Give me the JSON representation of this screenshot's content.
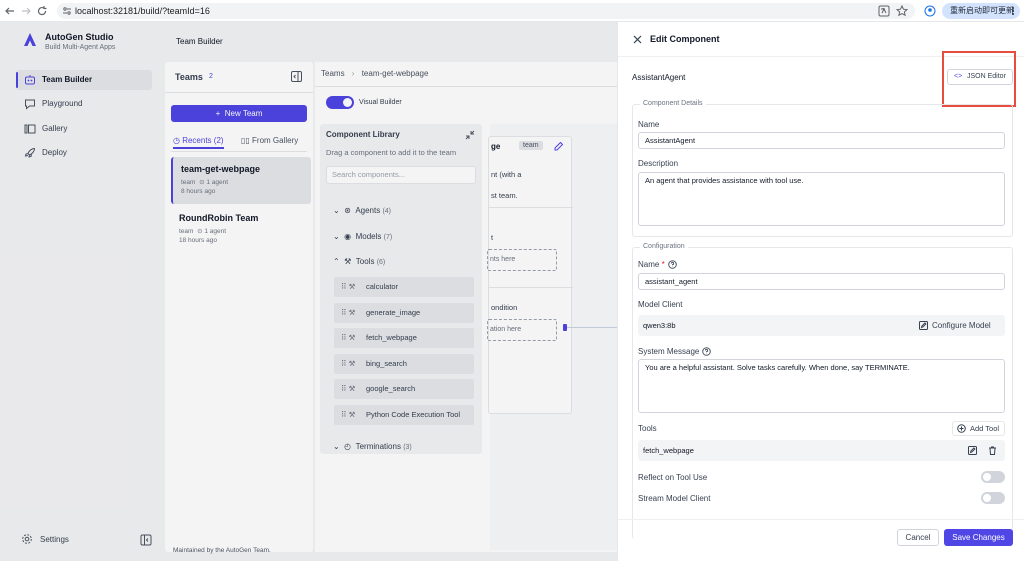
{
  "browser": {
    "url": "localhost:32181/build/?teamId=16",
    "update_label": "重新启动即可更新"
  },
  "brand": {
    "title": "AutoGen Studio",
    "subtitle": "Build Multi-Agent Apps"
  },
  "sidebar": {
    "items": [
      {
        "label": "Team Builder",
        "icon": "team-icon",
        "active": true
      },
      {
        "label": "Playground",
        "icon": "chat-icon"
      },
      {
        "label": "Gallery",
        "icon": "gallery-icon"
      },
      {
        "label": "Deploy",
        "icon": "rocket-icon"
      }
    ],
    "settings_label": "Settings"
  },
  "header": {
    "title": "Team Builder"
  },
  "teams_panel": {
    "title": "Teams",
    "count": "2",
    "new_team_label": "New Team",
    "tabs": [
      {
        "label": "Recents",
        "count": "(2)",
        "active": true
      },
      {
        "label": "From Gallery"
      }
    ],
    "teams": [
      {
        "name": "team-get-webpage",
        "type": "team",
        "agents": "1 agent",
        "time": "8 hours ago"
      },
      {
        "name": "RoundRobin Team",
        "type": "team",
        "agents": "1 agent",
        "time": "18 hours ago"
      }
    ]
  },
  "builder": {
    "breadcrumb_root": "Teams",
    "breadcrumb_current": "team-get-webpage",
    "visual_builder_label": "Visual Builder",
    "library_title": "Component Library",
    "library_subtitle": "Drag a component to add it to the team",
    "search_placeholder": "Search components...",
    "categories": [
      {
        "label": "Agents",
        "count": "(4)"
      },
      {
        "label": "Models",
        "count": "(7)"
      },
      {
        "label": "Tools",
        "count": "(6)"
      },
      {
        "label": "Terminations",
        "count": "(3)"
      }
    ],
    "tools": [
      "calculator",
      "generate_image",
      "fetch_webpage",
      "bing_search",
      "google_search",
      "Python Code Execution Tool"
    ],
    "node": {
      "title_fragment": "ge",
      "badge": "team",
      "desc_line1": "nt (with a",
      "desc_line2": "st team.",
      "slot1_title": "t",
      "slot1_drop": "nts here",
      "slot2_title": "ondition",
      "slot2_drop": "ation here"
    }
  },
  "footer": {
    "text": "Maintained by the AutoGen Team."
  },
  "drawer": {
    "title": "Edit Component",
    "component_label": "AssistantAgent",
    "json_editor_label": "JSON Editor",
    "details_legend": "Component Details",
    "name_label": "Name",
    "name_value": "AssistantAgent",
    "description_label": "Description",
    "description_value": "An agent that provides assistance with tool use.",
    "config_legend": "Configuration",
    "config_name_label": "Name",
    "config_name_required": "*",
    "config_name_value": "assistant_agent",
    "model_client_label": "Model Client",
    "model_client_value": "qwen3:8b",
    "configure_model_label": "Configure Model",
    "system_message_label": "System Message",
    "system_message_value": "You are a helpful assistant. Solve tasks carefully. When done, say TERMINATE.",
    "tools_label": "Tools",
    "add_tool_label": "Add Tool",
    "tool_value": "fetch_webpage",
    "reflect_label": "Reflect on Tool Use",
    "stream_label": "Stream Model Client",
    "cancel_label": "Cancel",
    "save_label": "Save Changes"
  },
  "colors": {
    "accent": "#4f46e5",
    "highlight": "#e74c3c"
  }
}
